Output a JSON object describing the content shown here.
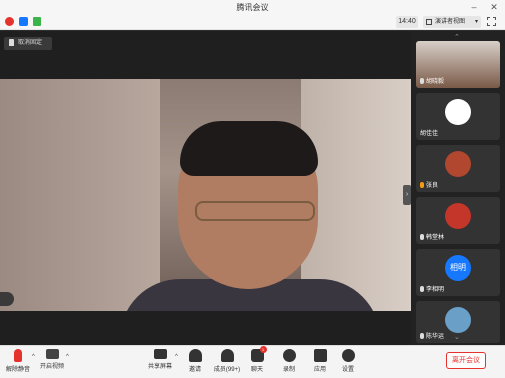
{
  "window": {
    "title": "腾讯会议",
    "minimize": "–",
    "close": "✕"
  },
  "toolbar": {
    "time": "14:40",
    "view_label": "演讲者视图",
    "view_caret": "▾"
  },
  "stage": {
    "unpin_label": "取消固定",
    "collapse_glyph": "›"
  },
  "participants": [
    {
      "name": "胡晓毅",
      "avatar_color": "#7a5a48"
    },
    {
      "name": "胡佳佳",
      "avatar_color": "#e65d3a"
    },
    {
      "name": "张良",
      "avatar_color": "#b0472e"
    },
    {
      "name": "韩堂林",
      "avatar_color": "#c4352a"
    },
    {
      "name": "李相明",
      "avatar_color": "#1677ff",
      "avatar_text": "相明"
    },
    {
      "name": "陈华运",
      "avatar_color": "#6aa0c8"
    }
  ],
  "bottombar": {
    "mute": "解除静音",
    "video": "开启视频",
    "share": "共享屏幕",
    "invite": "邀请",
    "members": "成员(99+)",
    "chat": "聊天",
    "chat_badge": "1",
    "record": "录制",
    "apps": "应用",
    "settings": "设置",
    "leave": "离开会议"
  },
  "colors": {
    "accent": "#1677ff",
    "danger": "#e5322d"
  }
}
